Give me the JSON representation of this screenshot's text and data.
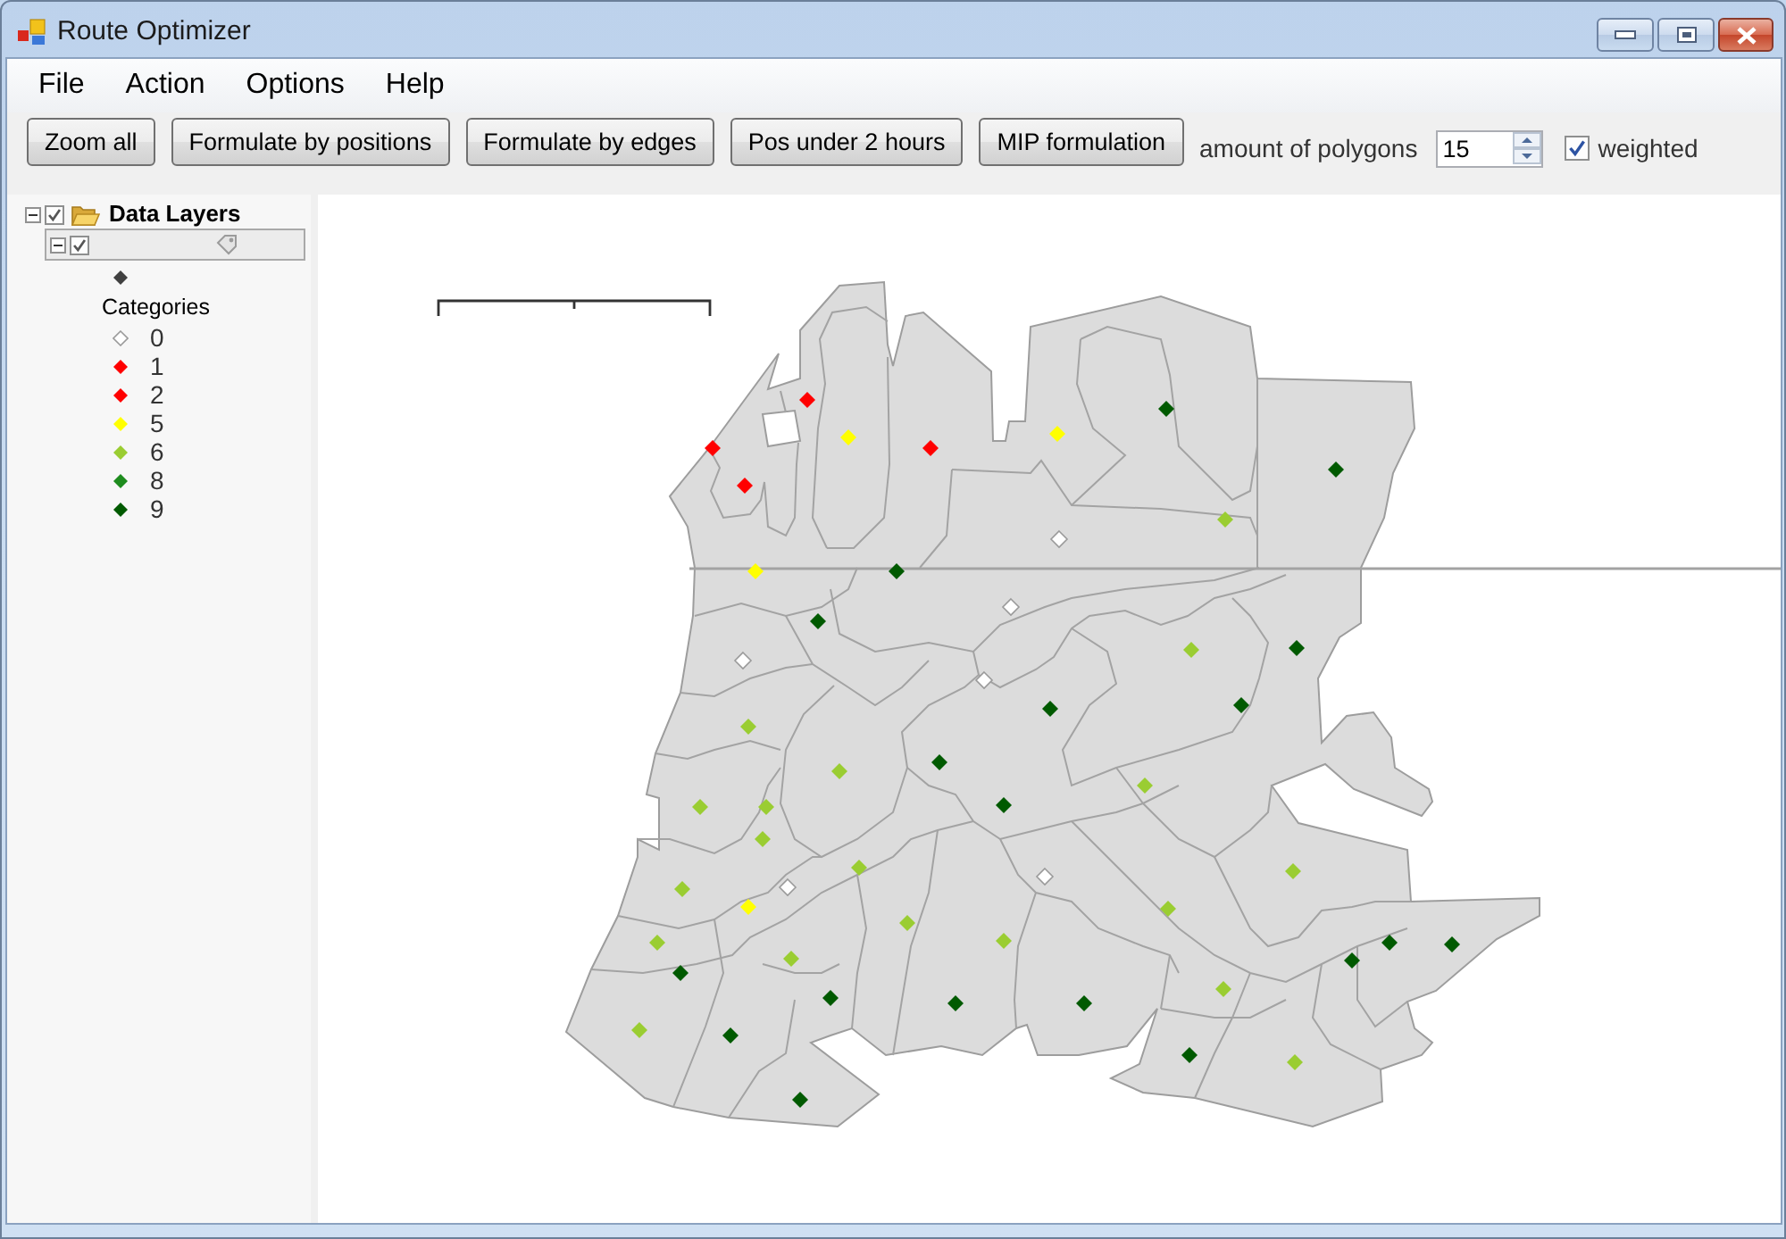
{
  "window": {
    "title": "Route Optimizer"
  },
  "menu": [
    "File",
    "Action",
    "Options",
    "Help"
  ],
  "toolbar": {
    "buttons": [
      "Zoom all",
      "Formulate by positions",
      "Formulate by edges",
      "Pos under 2 hours",
      "MIP formulation"
    ],
    "polygon_count": {
      "label": "amount of polygons",
      "value": "15"
    },
    "weighted": {
      "label": "weighted",
      "checked": true
    }
  },
  "layers": [
    {
      "label": "Data Layers",
      "expanded": true,
      "checked": true,
      "selected": false,
      "children": [
        {
          "expanded": true,
          "checked": true,
          "selected": true,
          "legend_title": "Categories",
          "categories": [
            {
              "label": "0",
              "color": "#ffffff"
            },
            {
              "label": "1",
              "color": "#ff0000"
            },
            {
              "label": "2",
              "color": "#ff0000"
            },
            {
              "label": "5",
              "color": "#ffff00"
            },
            {
              "label": "6",
              "color": "#9acd32"
            },
            {
              "label": "8",
              "color": "#1e8c1e"
            },
            {
              "label": "9",
              "color": "#005a00"
            }
          ]
        }
      ]
    }
  ],
  "map": {
    "markers": [
      {
        "color": "#ff0000"
      },
      {
        "color": "#005a00"
      },
      {
        "color": "#ffff00"
      },
      {
        "color": "#ffff00"
      },
      {
        "color": "#ff0000"
      },
      {
        "color": "#ff0000"
      },
      {
        "color": "#005a00"
      },
      {
        "color": "#ff0000"
      },
      {
        "color": "#9acd32"
      },
      {
        "color": "#ffffff"
      },
      {
        "color": "#ffff00"
      },
      {
        "color": "#005a00"
      },
      {
        "color": "#ffffff"
      },
      {
        "color": "#005a00"
      },
      {
        "color": "#9acd32"
      },
      {
        "color": "#005a00"
      },
      {
        "color": "#ffffff"
      },
      {
        "color": "#ffffff"
      },
      {
        "color": "#005a00"
      },
      {
        "color": "#005a00"
      },
      {
        "color": "#9acd32"
      },
      {
        "color": "#005a00"
      },
      {
        "color": "#9acd32"
      },
      {
        "color": "#9acd32"
      },
      {
        "color": "#9acd32"
      },
      {
        "color": "#9acd32"
      },
      {
        "color": "#005a00"
      },
      {
        "color": "#9acd32"
      },
      {
        "color": "#9acd32"
      },
      {
        "color": "#9acd32"
      },
      {
        "color": "#ffffff"
      },
      {
        "color": "#ffffff"
      },
      {
        "color": "#9acd32"
      },
      {
        "color": "#ffff00"
      },
      {
        "color": "#9acd32"
      },
      {
        "color": "#9acd32"
      },
      {
        "color": "#9acd32"
      },
      {
        "color": "#9acd32"
      },
      {
        "color": "#005a00"
      },
      {
        "color": "#005a00"
      },
      {
        "color": "#9acd32"
      },
      {
        "color": "#005a00"
      },
      {
        "color": "#005a00"
      },
      {
        "color": "#9acd32"
      },
      {
        "color": "#005a00"
      },
      {
        "color": "#005a00"
      },
      {
        "color": "#005a00"
      },
      {
        "color": "#9acd32"
      },
      {
        "color": "#005a00"
      },
      {
        "color": "#005a00"
      },
      {
        "color": "#9acd32"
      },
      {
        "color": "#005a00"
      }
    ]
  }
}
